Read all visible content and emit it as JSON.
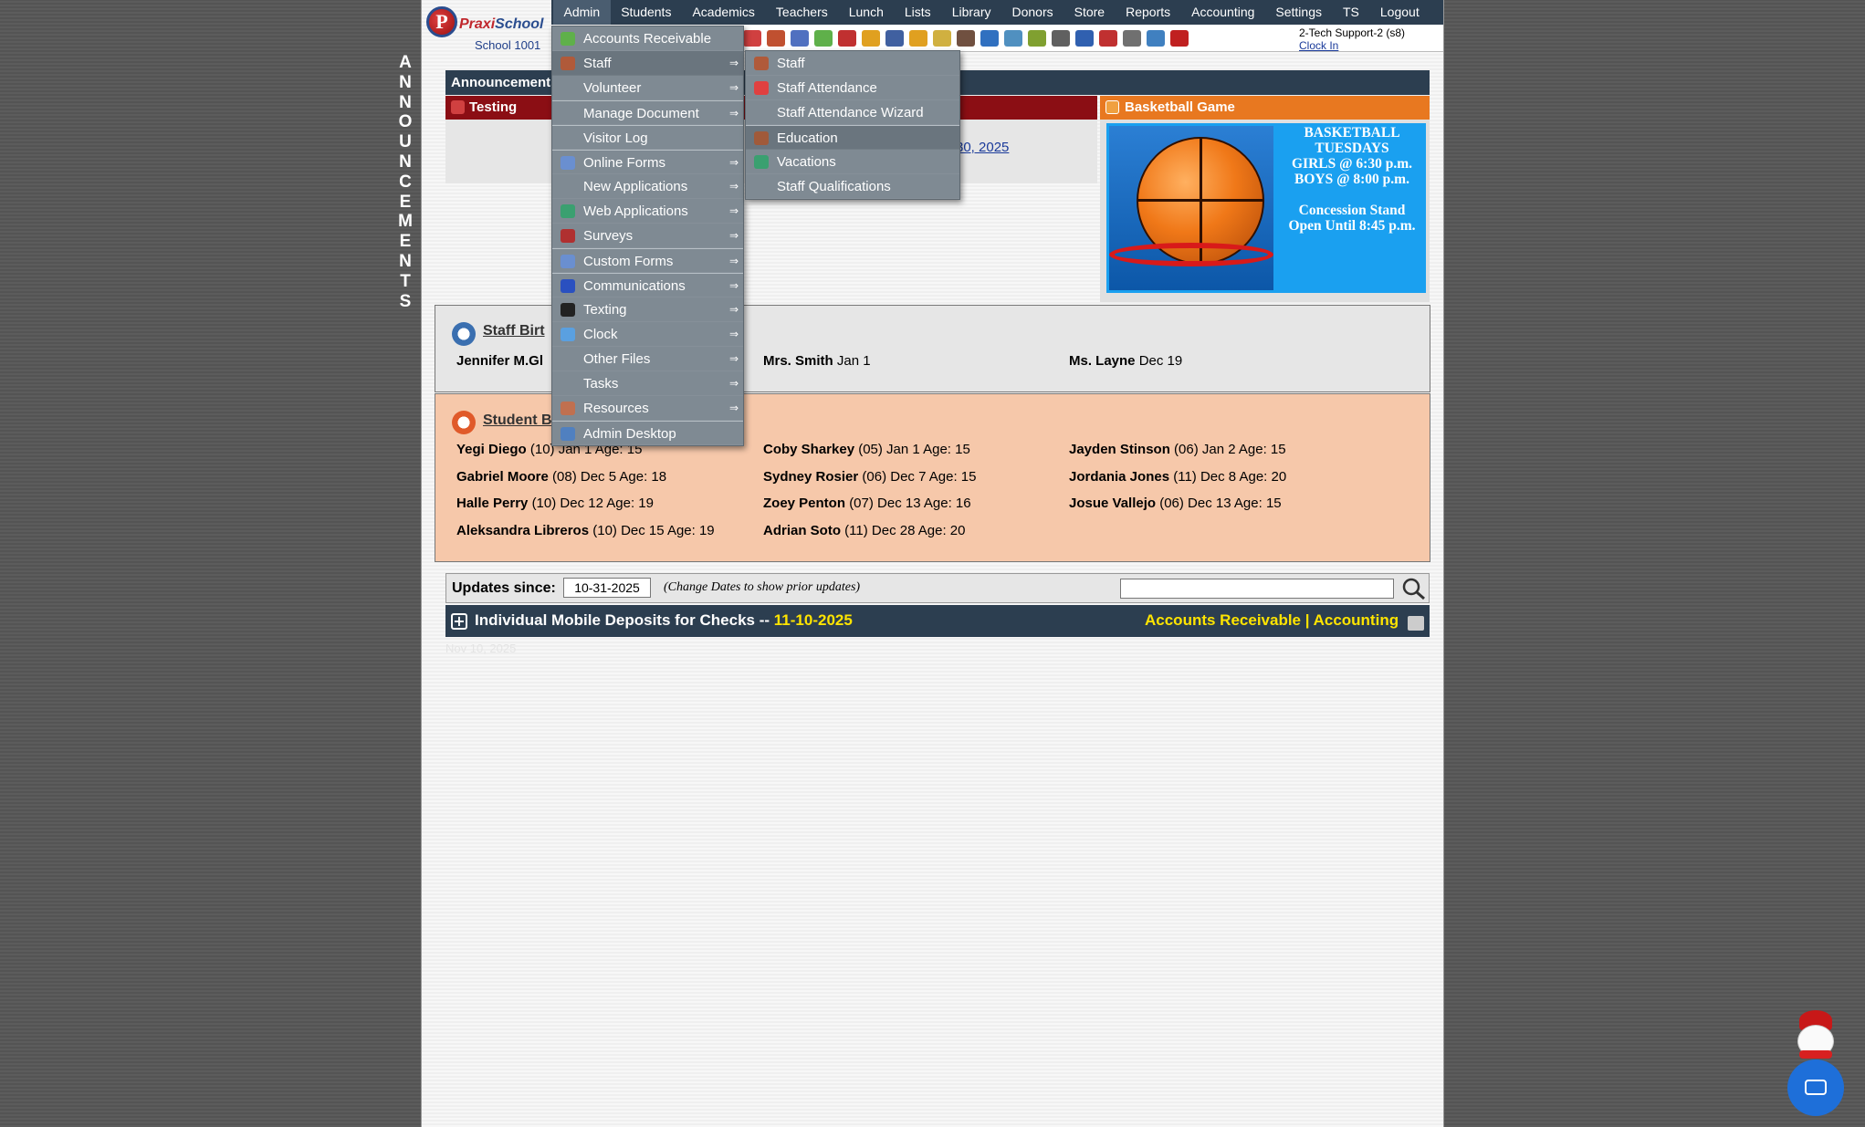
{
  "side_letters": [
    "A",
    "N",
    "N",
    "O",
    "U",
    "N",
    "C",
    "E",
    "M",
    "E",
    "N",
    "T",
    "S"
  ],
  "logo": {
    "brand_first": "Praxi",
    "brand_second": "School",
    "school": "School 1001"
  },
  "nav": [
    "Admin",
    "Students",
    "Academics",
    "Teachers",
    "Lunch",
    "Lists",
    "Library",
    "Donors",
    "Store",
    "Reports",
    "Accounting",
    "Settings",
    "TS",
    "Logout"
  ],
  "user": {
    "name": "2-Tech Support-2 (s8)",
    "clock_in": "Clock In"
  },
  "announcements": {
    "bar_label": "Announcements",
    "testing_label": "Testing",
    "testing_link": "30, 2025",
    "basketball_label": "Basketball Game",
    "basketball_lines": [
      "BASKETBALL",
      "TUESDAYS",
      "GIRLS @ 6:30 p.m.",
      "BOYS  @ 8:00 p.m.",
      "",
      "Concession Stand",
      "Open Until 8:45 p.m."
    ]
  },
  "staff_birthdays": {
    "title": "Staff Birt",
    "entries": [
      {
        "name": "Jennifer M.Gl",
        "detail": ""
      },
      {
        "name": "Mrs. Smith",
        "detail": "Jan 1"
      },
      {
        "name": "Ms. Layne",
        "detail": "Dec 19"
      }
    ]
  },
  "student_birthdays": {
    "title": "Student B",
    "entries": [
      {
        "name": "Yegi Diego",
        "detail": "(10) Jan 1 Age: 15"
      },
      {
        "name": "Coby Sharkey",
        "detail": "(05) Jan 1 Age: 15"
      },
      {
        "name": "Jayden Stinson",
        "detail": "(06) Jan 2 Age: 15"
      },
      {
        "name": "Gabriel Moore",
        "detail": "(08) Dec 5 Age: 18"
      },
      {
        "name": "Sydney Rosier",
        "detail": "(06) Dec 7 Age: 15"
      },
      {
        "name": "Jordania Jones",
        "detail": "(11) Dec 8 Age: 20"
      },
      {
        "name": "Halle Perry",
        "detail": "(10) Dec 12 Age: 19"
      },
      {
        "name": "Zoey Penton",
        "detail": "(07) Dec 13 Age: 16"
      },
      {
        "name": "Josue Vallejo",
        "detail": "(06) Dec 13 Age: 15"
      },
      {
        "name": "Aleksandra Libreros",
        "detail": "(10) Dec 15 Age: 19"
      },
      {
        "name": "Adrian Soto",
        "detail": "(11) Dec 28 Age: 20"
      }
    ]
  },
  "updates": {
    "label": "Updates since:",
    "date": "10-31-2025",
    "hint": "(Change Dates to show prior updates)",
    "search_placeholder": ""
  },
  "deposits": {
    "title": "Individual Mobile Deposits for Checks",
    "sep": " -- ",
    "date": "11-10-2025",
    "link_ar": "Accounts Receivable",
    "link_sep": " | ",
    "link_acc": "Accounting"
  },
  "faded_text": "Nov 10, 2025",
  "admin_menu": [
    {
      "label": "Accounts Receivable",
      "icon": "money-icon",
      "color": "#5fb04a",
      "arrow": false,
      "sep": false
    },
    {
      "label": "Staff",
      "icon": "staff-icon",
      "color": "#b05a3a",
      "arrow": true,
      "sep": false,
      "hl": true
    },
    {
      "label": "Volunteer",
      "icon": "",
      "color": "",
      "arrow": true,
      "sep": false
    },
    {
      "label": "Manage Document",
      "icon": "",
      "color": "",
      "arrow": true,
      "sep": true
    },
    {
      "label": "Visitor Log",
      "icon": "",
      "color": "",
      "arrow": false,
      "sep": true
    },
    {
      "label": "Online Forms",
      "icon": "web-form-icon",
      "color": "#6a8fd0",
      "arrow": true,
      "sep": true
    },
    {
      "label": "New Applications",
      "icon": "",
      "color": "",
      "arrow": true,
      "sep": false
    },
    {
      "label": "Web Applications",
      "icon": "globe-icon",
      "color": "#3aa070",
      "arrow": true,
      "sep": false
    },
    {
      "label": "Surveys",
      "icon": "survey-icon",
      "color": "#b03030",
      "arrow": true,
      "sep": false
    },
    {
      "label": "Custom Forms",
      "icon": "custom-form-icon",
      "color": "#6a8fd0",
      "arrow": true,
      "sep": true
    },
    {
      "label": "Communications",
      "icon": "at-icon",
      "color": "#2a50c0",
      "arrow": true,
      "sep": true
    },
    {
      "label": "Texting",
      "icon": "phone-icon",
      "color": "#222222",
      "arrow": true,
      "sep": false
    },
    {
      "label": "Clock",
      "icon": "clock-icon",
      "color": "#5aa0e0",
      "arrow": true,
      "sep": false
    },
    {
      "label": "Other Files",
      "icon": "",
      "color": "",
      "arrow": true,
      "sep": false
    },
    {
      "label": "Tasks",
      "icon": "",
      "color": "",
      "arrow": true,
      "sep": false
    },
    {
      "label": "Resources",
      "icon": "resources-icon",
      "color": "#c07050",
      "arrow": true,
      "sep": false
    },
    {
      "label": "Admin Desktop",
      "icon": "desktop-icon",
      "color": "#5080c0",
      "arrow": false,
      "sep": true
    }
  ],
  "staff_submenu": [
    {
      "label": "Staff",
      "icon": "staff-icon",
      "color": "#b05a3a",
      "sep": false
    },
    {
      "label": "Staff Attendance",
      "icon": "calendar-icon",
      "color": "#e04040",
      "sep": false
    },
    {
      "label": "Staff Attendance Wizard",
      "icon": "",
      "color": "",
      "sep": false
    },
    {
      "label": "Education",
      "icon": "teacher-icon",
      "color": "#a05a3a",
      "sep": true,
      "hl": true
    },
    {
      "label": "Vacations",
      "icon": "vacation-icon",
      "color": "#3aa070",
      "sep": false
    },
    {
      "label": "Staff Qualifications",
      "icon": "",
      "color": "",
      "sep": false
    }
  ],
  "toolbar_icons": [
    {
      "name": "megaphone-icon",
      "color": "#d04040"
    },
    {
      "name": "student-icon",
      "color": "#c05030"
    },
    {
      "name": "student-group-icon",
      "color": "#5070c0"
    },
    {
      "name": "money-icon",
      "color": "#5fb04a"
    },
    {
      "name": "family-icon",
      "color": "#c03030"
    },
    {
      "name": "lunch-icon",
      "color": "#e0a020"
    },
    {
      "name": "book-icon",
      "color": "#4060a0"
    },
    {
      "name": "pencil-icon",
      "color": "#e0a020"
    },
    {
      "name": "mail-icon",
      "color": "#d0b040"
    },
    {
      "name": "teacher-icon",
      "color": "#705040"
    },
    {
      "name": "timer-icon",
      "color": "#3070c0"
    },
    {
      "name": "table-icon",
      "color": "#5090c0"
    },
    {
      "name": "ticket-icon",
      "color": "#80a030"
    },
    {
      "name": "printer-icon",
      "color": "#606060"
    },
    {
      "name": "ap-icon",
      "color": "#3060b0"
    },
    {
      "name": "pdf-icon",
      "color": "#c03030"
    },
    {
      "name": "cash-icon",
      "color": "#707070"
    },
    {
      "name": "help-icon",
      "color": "#4080c0"
    },
    {
      "name": "power-icon",
      "color": "#c02020"
    }
  ]
}
